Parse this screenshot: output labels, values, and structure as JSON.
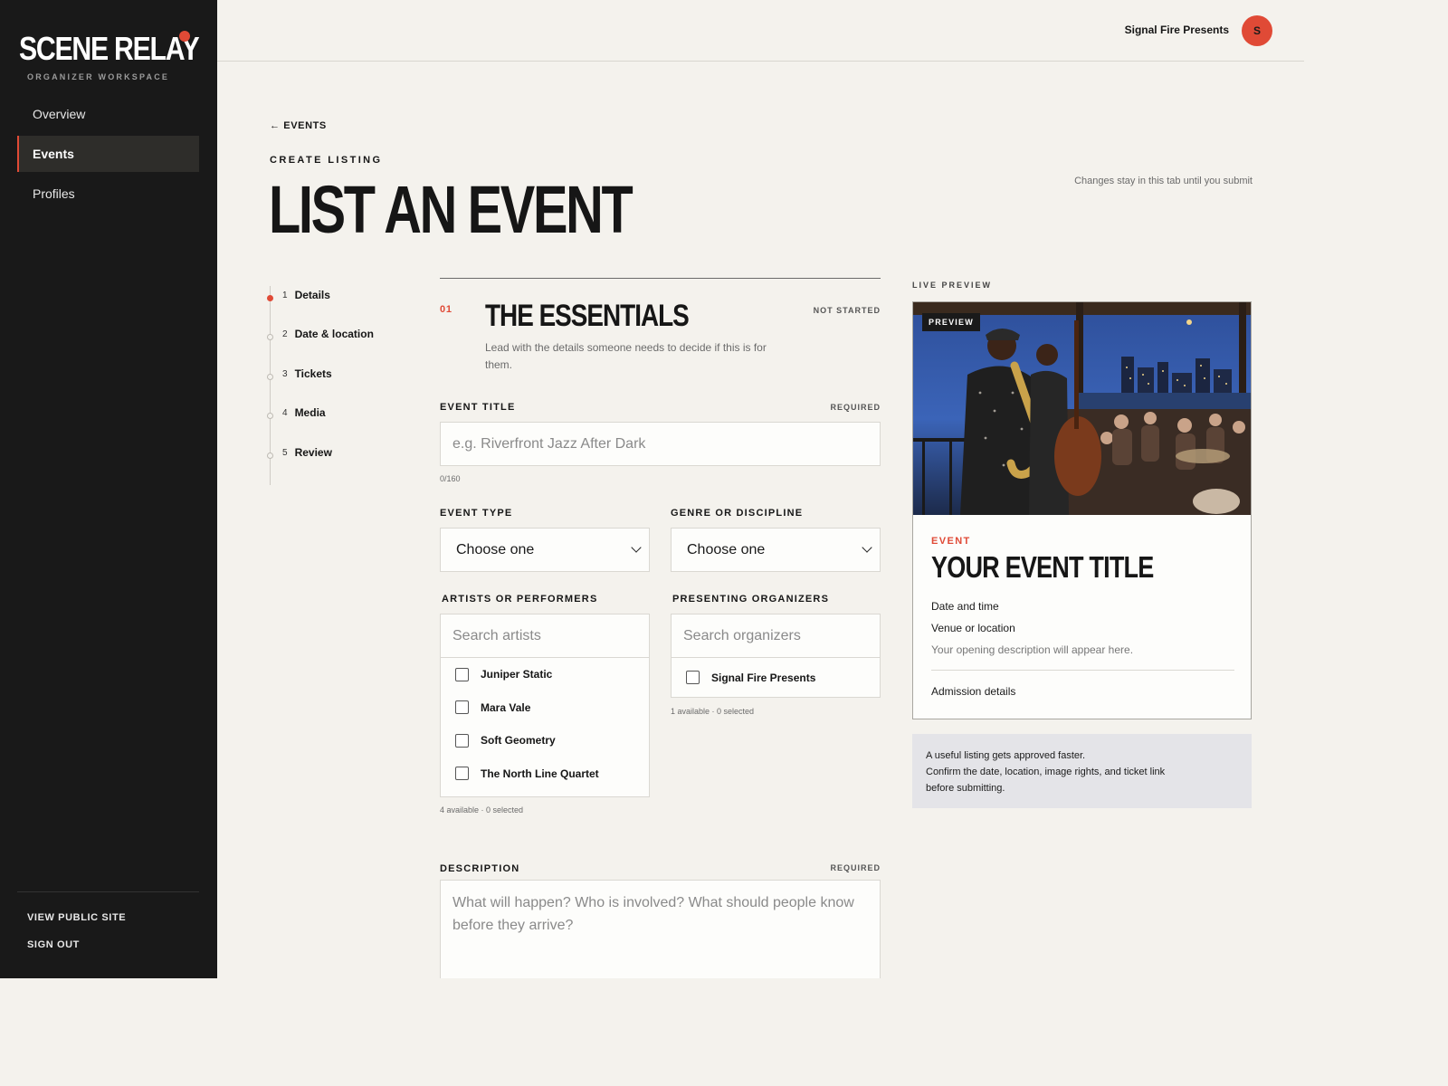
{
  "brand": {
    "name": "SCENE RELAY",
    "subtitle": "ORGANIZER WORKSPACE",
    "accent": "#e04a36"
  },
  "sidebar": {
    "items": [
      {
        "label": "Overview",
        "active": false
      },
      {
        "label": "Events",
        "active": true
      },
      {
        "label": "Profiles",
        "active": false
      }
    ],
    "view_public": "VIEW PUBLIC SITE",
    "sign_out": "SIGN OUT"
  },
  "topbar": {
    "org_name": "Signal Fire Presents",
    "avatar_initial": "S"
  },
  "header": {
    "back": "← EVENTS",
    "eyebrow": "CREATE LISTING",
    "title": "LIST AN EVENT",
    "draft_note": "Changes stay in this tab until you submit"
  },
  "steps": [
    {
      "num": "1",
      "label": "Details",
      "active": true
    },
    {
      "num": "2",
      "label": "Date & location",
      "active": false
    },
    {
      "num": "3",
      "label": "Tickets",
      "active": false
    },
    {
      "num": "4",
      "label": "Media",
      "active": false
    },
    {
      "num": "5",
      "label": "Review",
      "active": false
    }
  ],
  "section": {
    "num": "01",
    "title": "THE ESSENTIALS",
    "status": "NOT STARTED",
    "desc": "Lead with the details someone needs to decide if this is for them."
  },
  "fields": {
    "title": {
      "label": "EVENT TITLE",
      "required": "REQUIRED",
      "placeholder": "e.g. Riverfront Jazz After Dark",
      "count": "0/160"
    },
    "event_type": {
      "label": "EVENT TYPE",
      "value": "Choose one"
    },
    "genre": {
      "label": "GENRE OR DISCIPLINE",
      "value": "Choose one"
    },
    "artists": {
      "label": "ARTISTS OR PERFORMERS",
      "placeholder": "Search artists",
      "options": [
        "Juniper Static",
        "Mara Vale",
        "Soft Geometry",
        "The North Line Quartet"
      ],
      "hint": "4 available · 0 selected"
    },
    "organizers": {
      "label": "PRESENTING ORGANIZERS",
      "placeholder": "Search organizers",
      "options": [
        "Signal Fire Presents"
      ],
      "hint": "1 available · 0 selected"
    },
    "description": {
      "label": "DESCRIPTION",
      "required": "REQUIRED",
      "placeholder": "What will happen? Who is involved? What should people know before they arrive?"
    }
  },
  "preview": {
    "label": "LIVE PREVIEW",
    "badge": "PREVIEW",
    "kicker": "EVENT",
    "title": "YOUR EVENT TITLE",
    "date": "Date and time",
    "venue": "Venue or location",
    "desc": "Your opening description will appear here.",
    "admission": "Admission details"
  },
  "tip": {
    "line1": "A useful listing gets approved faster.",
    "line2": "Confirm the date, location, image rights, and ticket link",
    "line3": "before submitting."
  }
}
